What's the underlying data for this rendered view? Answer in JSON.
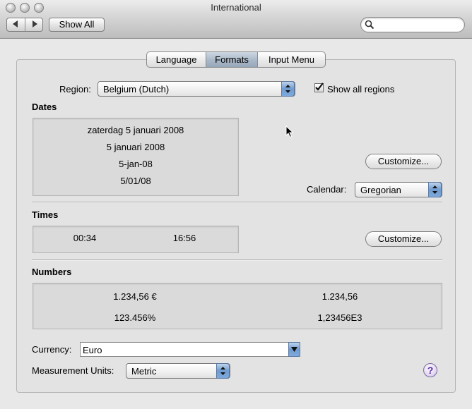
{
  "window": {
    "title": "International",
    "traffic_lights": [
      "close",
      "minimize",
      "zoom"
    ]
  },
  "toolbar": {
    "back_icon": "back-arrow-icon",
    "forward_icon": "forward-arrow-icon",
    "show_all_label": "Show All",
    "search_placeholder": ""
  },
  "tabs": [
    {
      "label": "Language",
      "selected": false
    },
    {
      "label": "Formats",
      "selected": true
    },
    {
      "label": "Input Menu",
      "selected": false
    }
  ],
  "region": {
    "label": "Region:",
    "value": "Belgium (Dutch)",
    "show_all_label": "Show all regions",
    "show_all_checked": true
  },
  "dates": {
    "title": "Dates",
    "samples": [
      "zaterdag 5 januari 2008",
      "5 januari 2008",
      "5-jan-08",
      "5/01/08"
    ],
    "customize_label": "Customize...",
    "calendar_label": "Calendar:",
    "calendar_value": "Gregorian"
  },
  "times": {
    "title": "Times",
    "samples": [
      "00:34",
      "16:56"
    ],
    "customize_label": "Customize..."
  },
  "numbers": {
    "title": "Numbers",
    "samples": [
      "1.234,56 €",
      "1.234,56",
      "123.456%",
      "1,23456E3"
    ]
  },
  "currency": {
    "label": "Currency:",
    "value": "Euro"
  },
  "measurement": {
    "label": "Measurement Units:",
    "value": "Metric"
  },
  "help": {
    "label": "?"
  },
  "colors": {
    "accent": "#6f9bd0",
    "selected_tab": "#a9b8c8",
    "help": "#5b2aa2"
  }
}
